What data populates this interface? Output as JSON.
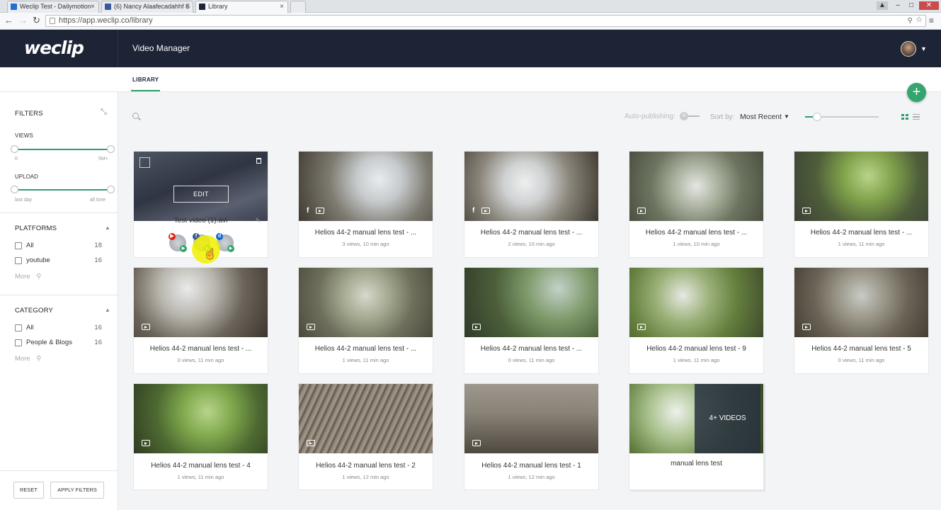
{
  "browser": {
    "tabs": [
      {
        "label": "Weclip Test - Dailymotion",
        "favicon_color": "#1f6fd6"
      },
      {
        "label": "(6) Nancy Alaafecadahhf S",
        "favicon_color": "#3b5998"
      },
      {
        "label": "Library",
        "favicon_color": "#1d2436"
      }
    ],
    "url": "https://app.weclip.co/library",
    "window_controls": {
      "minimize": "–",
      "maximize": "□",
      "close": "✕"
    }
  },
  "header": {
    "logo": "weclip",
    "title": "Video Manager"
  },
  "subnav": {
    "tab_library": "LIBRARY"
  },
  "fab": "+",
  "sidebar": {
    "filters_title": "FILTERS",
    "views": {
      "label": "VIEWS",
      "min": "0",
      "max": "5M+"
    },
    "upload": {
      "label": "UPLOAD",
      "min": "last day",
      "max": "all time"
    },
    "platforms": {
      "title": "PLATFORMS",
      "items": [
        {
          "label": "All",
          "count": "18"
        },
        {
          "label": "youtube",
          "count": "16"
        }
      ],
      "more": "More"
    },
    "category": {
      "title": "CATEGORY",
      "items": [
        {
          "label": "All",
          "count": "16"
        },
        {
          "label": "People & Blogs",
          "count": "16"
        }
      ],
      "more": "More"
    },
    "reset": "RESET",
    "apply": "APPLY FILTERS"
  },
  "toolbar": {
    "auto_publishing": "Auto-publishing:",
    "sort_by": "Sort by:",
    "sort_value": "Most Recent"
  },
  "videos": [
    {
      "title": "Test video (1).avi",
      "edit": "EDIT",
      "meta": ""
    },
    {
      "title": "Helios 44-2 manual lens test - ...",
      "meta": "3 views, 10 min ago"
    },
    {
      "title": "Helios 44-2 manual lens test - ...",
      "meta": "2 views, 10 min ago"
    },
    {
      "title": "Helios 44-2 manual lens test - ...",
      "meta": "1 views, 10 min ago"
    },
    {
      "title": "Helios 44-2 manual lens test - ...",
      "meta": "1 views, 11 min ago"
    },
    {
      "title": "Helios 44-2 manual lens test - ...",
      "meta": "0 views, 11 min ago"
    },
    {
      "title": "Helios 44-2 manual lens test - ...",
      "meta": "1 views, 11 min ago"
    },
    {
      "title": "Helios 44-2 manual lens test - ...",
      "meta": "0 views, 11 min ago"
    },
    {
      "title": "Helios 44-2 manual lens test - 9",
      "meta": "1 views, 11 min ago"
    },
    {
      "title": "Helios 44-2 manual lens test - 5",
      "meta": "0 views, 11 min ago"
    },
    {
      "title": "Helios 44-2 manual lens test - 4",
      "meta": "1 views, 11 min ago"
    },
    {
      "title": "Helios 44-2 manual lens test - 2",
      "meta": "1 views, 12 min ago"
    },
    {
      "title": "Helios 44-2 manual lens test - 1",
      "meta": "1 views, 12 min ago"
    }
  ],
  "playlist": {
    "title": "manual lens test",
    "overlay": "4+ VIDEOS"
  },
  "platform_badges": [
    {
      "icon": "youtube-icon",
      "color": "#e62117"
    },
    {
      "icon": "facebook-icon",
      "color": "#3b5998"
    },
    {
      "icon": "dailymotion-icon",
      "color": "#0d66d0"
    }
  ],
  "colors": {
    "accent": "#2f9e6e",
    "header_bg": "#1d2436"
  }
}
